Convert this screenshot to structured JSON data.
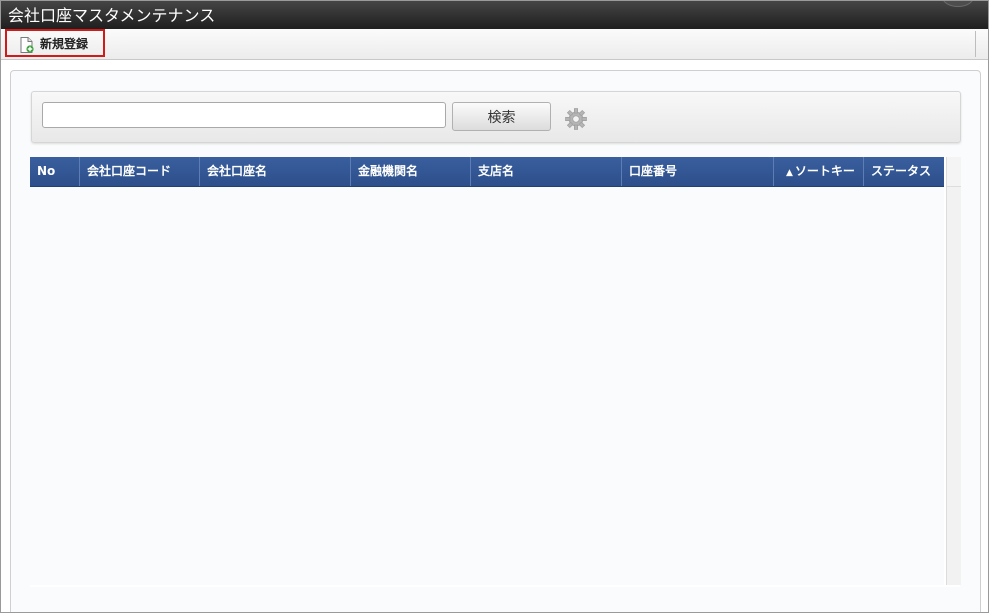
{
  "window": {
    "title": "会社口座マスタメンテナンス"
  },
  "toolbar": {
    "new_label": "新規登録",
    "new_icon": "new-document-icon",
    "highlight_color": "#d11a1a"
  },
  "search": {
    "value": "",
    "placeholder": "",
    "button_label": "検索",
    "settings_icon": "gear-icon"
  },
  "grid": {
    "header_color": "#2f548f",
    "columns": [
      {
        "label": "No"
      },
      {
        "label": "会社口座コード"
      },
      {
        "label": "会社口座名"
      },
      {
        "label": "金融機関名"
      },
      {
        "label": "支店名"
      },
      {
        "label": "口座番号"
      },
      {
        "label": "ソートキー",
        "sort": "ascending",
        "sort_icon": "sort-ascending-icon"
      },
      {
        "label": "ステータス"
      }
    ],
    "rows": []
  }
}
